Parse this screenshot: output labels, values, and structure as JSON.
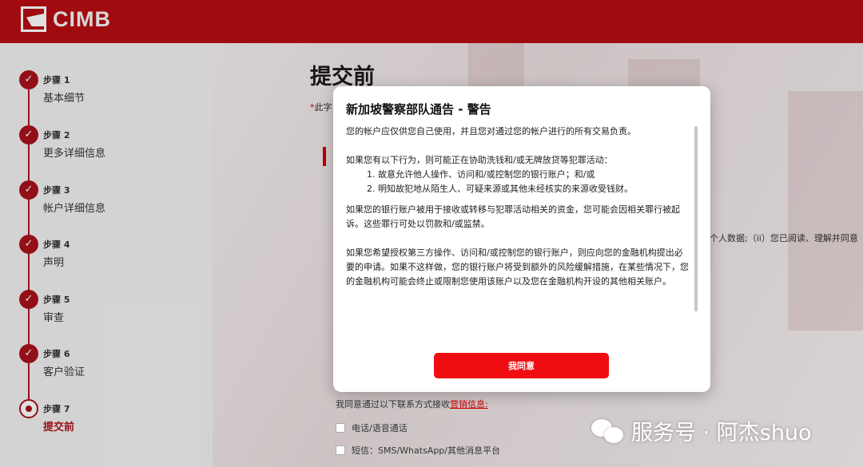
{
  "header": {
    "brand": "CIMB",
    "logo_icon": "cimb-logo-icon",
    "color": "#b70d12"
  },
  "sidebar": {
    "steps": [
      {
        "num": "步骤 1",
        "title": "基本细节",
        "state": "done"
      },
      {
        "num": "步骤 2",
        "title": "更多详细信息",
        "state": "done"
      },
      {
        "num": "步骤 3",
        "title": "帐户详细信息",
        "state": "done"
      },
      {
        "num": "步骤 4",
        "title": "声明",
        "state": "done"
      },
      {
        "num": "步骤 5",
        "title": "审查",
        "state": "done"
      },
      {
        "num": "步骤 6",
        "title": "客户验证",
        "state": "done"
      },
      {
        "num": "步骤 7",
        "title": "提交前",
        "state": "current"
      }
    ],
    "check_glyph": "✓"
  },
  "main": {
    "title": "提交前",
    "required_note": "此字",
    "required_star": "*",
    "right_fragment": "个人数据;（ii）您已阅读、理解并同意",
    "consent_text": "我同意通过以下联系方式接收",
    "consent_link": "营销信息:",
    "options": [
      "电话/语音通话",
      "短信：SMS/WhatsApp/其他消息平台"
    ]
  },
  "modal": {
    "title": "新加坡警察部队通告 - 警告",
    "p1": "您的帐户应仅供您自己使用，并且您对通过您的帐户进行的所有交易负责。",
    "p2_intro": "如果您有以下行为，则可能正在协助洗钱和/或无牌放贷等犯罪活动：",
    "p2_items": [
      "1. 故意允许他人操作、访问和/或控制您的银行账户；和/或",
      "2. 明知故犯地从陌生人、可疑来源或其他未经核实的来源收受钱财。"
    ],
    "p3": "如果您的银行账户被用于接收或转移与犯罪活动相关的资金，您可能会因相关罪行被起诉。这些罪行可处以罚款和/或监禁。",
    "p4": "如果您希望授权第三方操作、访问和/或控制您的银行账户，则应向您的金融机构提出必要的申请。如果不这样做，您的银行账户将受到额外的风险缓解措施，在某些情况下，您的金融机构可能会终止或限制您使用该账户以及您在金融机构开设的其他相关账户。",
    "agree_label": "我同意",
    "button_color": "#f00d12"
  },
  "watermark": {
    "text": "服务号 · 阿杰shuo",
    "icon": "wechat-icon"
  }
}
